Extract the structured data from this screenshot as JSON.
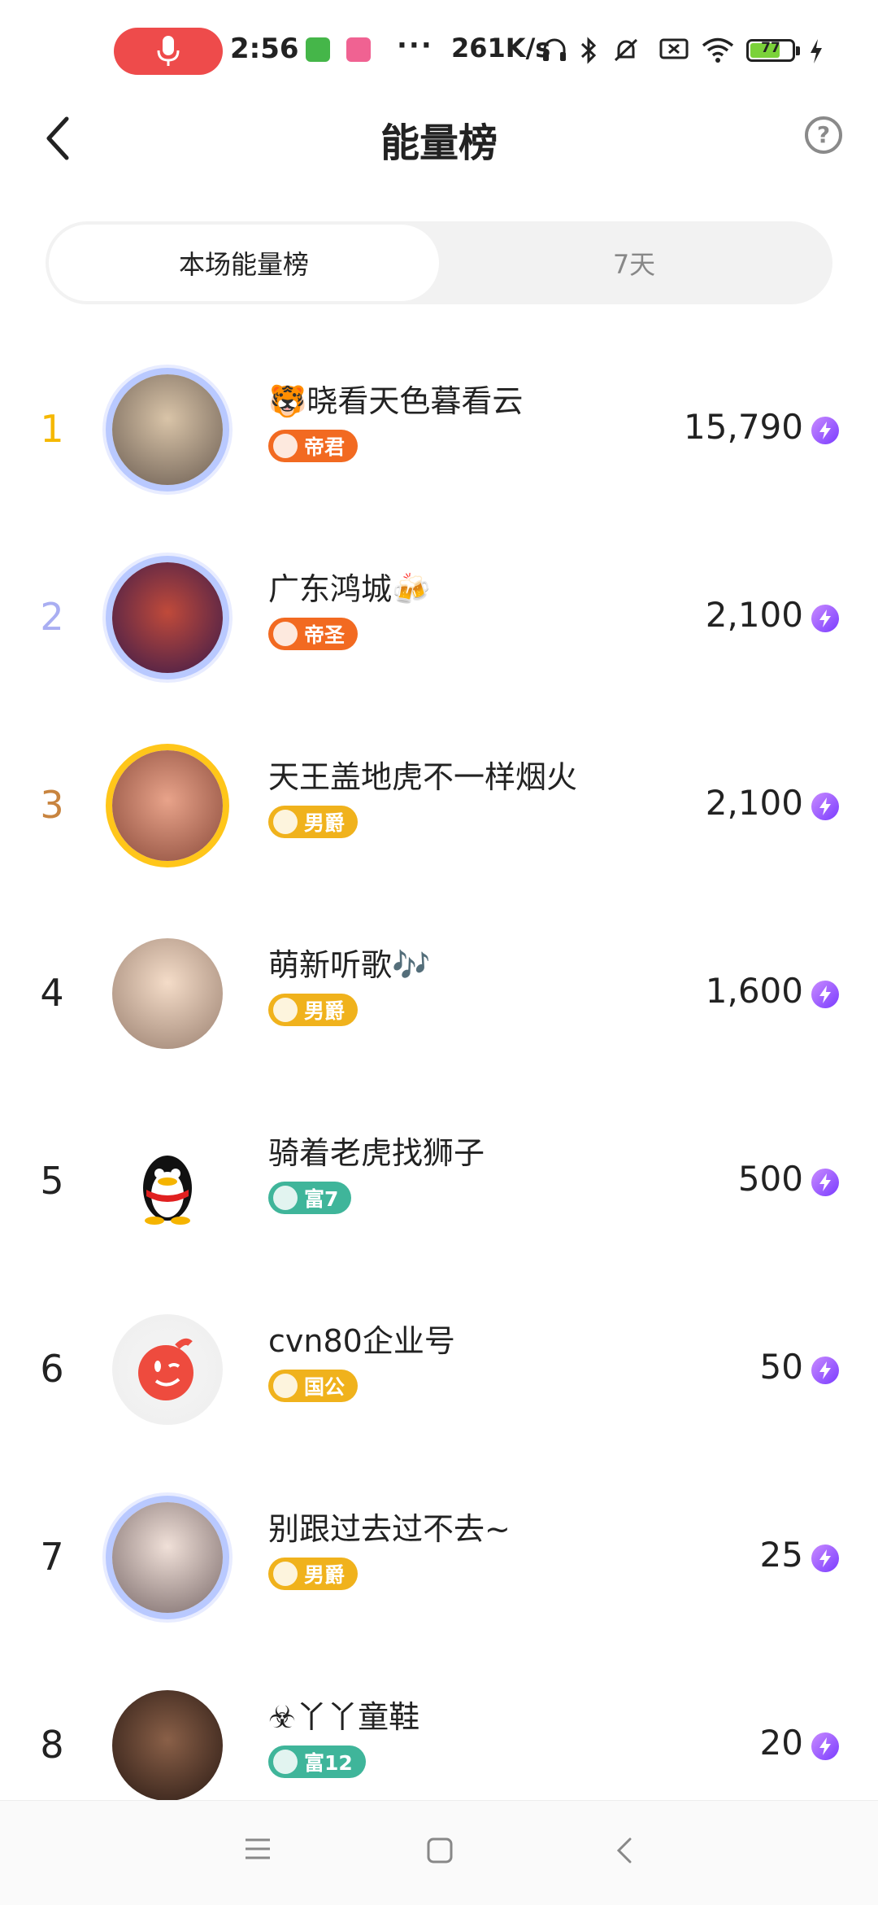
{
  "status_bar": {
    "time": "2:56",
    "more": "···",
    "net_speed": "261K/s",
    "battery_level": "77"
  },
  "header": {
    "title": "能量榜",
    "help_symbol": "?"
  },
  "tabs": [
    {
      "label": "本场能量榜"
    },
    {
      "label": "7天"
    }
  ],
  "ranking": [
    {
      "rank": "1",
      "name": "🐯晓看天色暮看云",
      "badge": "帝君",
      "score": "15,790",
      "rank_color": "#f5b800",
      "badge_color": "#f26a21"
    },
    {
      "rank": "2",
      "name": "广东鸿城🍻",
      "badge": "帝圣",
      "score": "2,100",
      "rank_color": "#a9aef2",
      "badge_color": "#f26a21"
    },
    {
      "rank": "3",
      "name": "天王盖地虎不一样烟火",
      "badge": "男爵",
      "score": "2,100",
      "rank_color": "#c8843f",
      "badge_color": "#f0b21c"
    },
    {
      "rank": "4",
      "name": "萌新听歌🎶",
      "badge": "男爵",
      "score": "1,600",
      "rank_color": "#222222",
      "badge_color": "#f0b21c"
    },
    {
      "rank": "5",
      "name": "骑着老虎找狮子",
      "badge": "富7",
      "score": "500",
      "rank_color": "#222222",
      "badge_color": "#3fb59a"
    },
    {
      "rank": "6",
      "name": "cvn80企业号",
      "badge": "国公",
      "score": "50",
      "rank_color": "#222222",
      "badge_color": "#f0b21c"
    },
    {
      "rank": "7",
      "name": "别跟过去过不去~",
      "badge": "男爵",
      "score": "25",
      "rank_color": "#222222",
      "badge_color": "#f0b21c"
    },
    {
      "rank": "8",
      "name": "☣丫丫童鞋",
      "badge": "富12",
      "score": "20",
      "rank_color": "#222222",
      "badge_color": "#3fb59a"
    }
  ],
  "icons": {
    "score_unit": "lightning-icon",
    "back": "chevron-left-icon",
    "help": "question-circle-icon"
  }
}
